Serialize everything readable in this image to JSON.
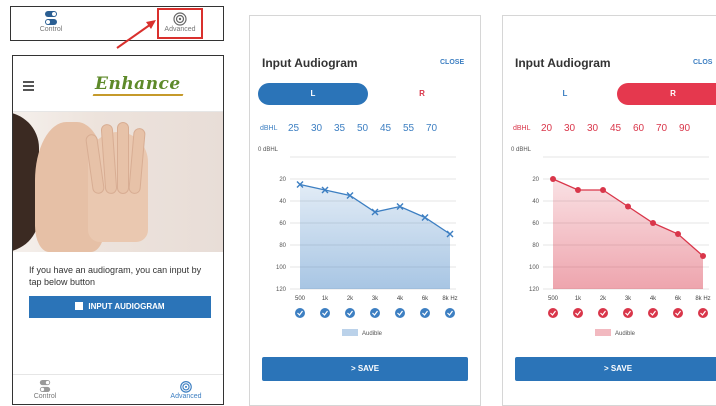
{
  "top_nav": {
    "control_label": "Control",
    "advanced_label": "Advanced"
  },
  "phone": {
    "logo_text": "Enhance",
    "description": "If you have an audiogram, you can input by tap below button",
    "input_button_label": "INPUT AUDIOGRAM",
    "bottom_nav": {
      "control_label": "Control",
      "advanced_label": "Advanced"
    }
  },
  "audiogram_left": {
    "title": "Input Audiogram",
    "close_label": "CLOSE",
    "toggle_left": "L",
    "toggle_right": "R",
    "dbhl_label": "dBHL",
    "values": [
      "25",
      "30",
      "35",
      "50",
      "45",
      "55",
      "70"
    ],
    "y_top_label": "0 dBHL",
    "y_ticks": [
      "20",
      "40",
      "60",
      "80",
      "100",
      "120"
    ],
    "x_ticks": [
      "500",
      "1k",
      "2k",
      "3k",
      "4k",
      "6k",
      "8k Hz"
    ],
    "legend": "Audible",
    "save_label": "> SAVE",
    "color": "#3d7fc2"
  },
  "audiogram_right": {
    "title": "Input Audiogram",
    "close_label": "CLOS",
    "toggle_left": "L",
    "toggle_right": "R",
    "dbhl_label": "dBHL",
    "values": [
      "20",
      "30",
      "30",
      "45",
      "60",
      "70",
      "90"
    ],
    "y_top_label": "0 dBHL",
    "y_ticks": [
      "20",
      "40",
      "60",
      "80",
      "100",
      "120"
    ],
    "x_ticks": [
      "500",
      "1k",
      "2k",
      "3k",
      "4k",
      "6k",
      "8k Hz"
    ],
    "legend": "Audible",
    "save_label": "> SAVE",
    "color": "#d9364a"
  }
}
